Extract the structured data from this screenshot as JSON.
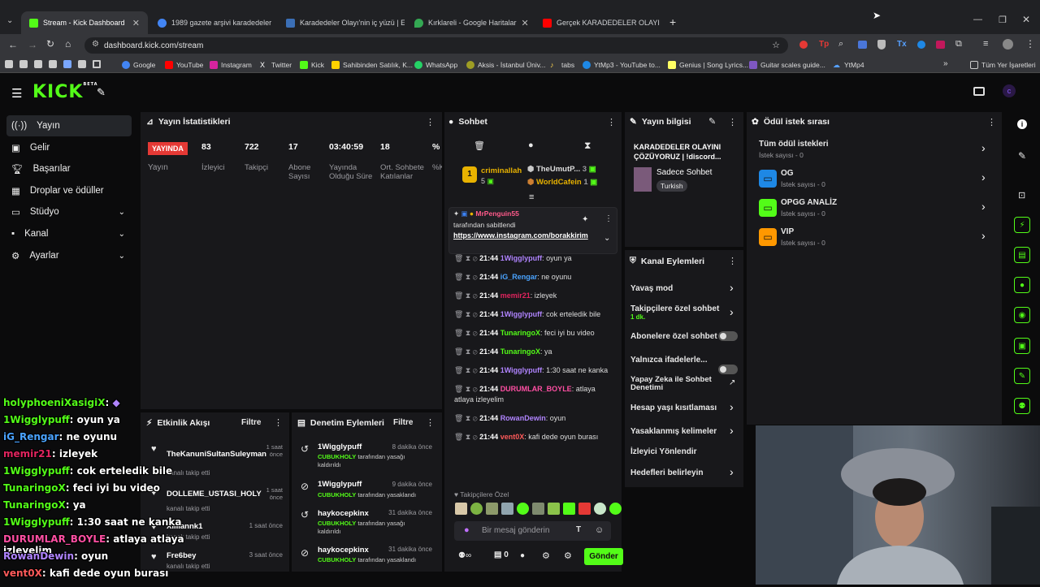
{
  "browser": {
    "tabs": [
      {
        "title": "Stream - Kick Dashboard",
        "color": "#53fc18"
      },
      {
        "title": "1989 gazete arşivi karadedeler",
        "color": "#4285f4"
      },
      {
        "title": "Karadedeler Olayı'nin iç yüzü | E",
        "color": "#3b6fb6"
      },
      {
        "title": "Kırklareli - Google Haritalar",
        "color": "#34a853"
      },
      {
        "title": "Gerçek KARADEDELER OLAYI - Y",
        "color": "#ff0000"
      }
    ],
    "url": "dashboard.kick.com/stream",
    "bookmarks": [
      "Google",
      "YouTube",
      "Instagram",
      "Twitter",
      "Kick",
      "Sahibinden Satılık, K...",
      "WhatsApp",
      "Aksis - İstanbul Üniv...",
      "tabs",
      "YtMp3 - YouTube to...",
      "Genius | Song Lyrics...",
      "Guitar scales guide...",
      "YtMp4"
    ],
    "all_bookmarks": "Tüm Yer İşaretleri"
  },
  "kick": {
    "logo": "KICK",
    "beta": "BETA"
  },
  "sidebar": {
    "items": [
      {
        "label": "Yayın",
        "icon": "radio-icon"
      },
      {
        "label": "Gelir",
        "icon": "dollar-icon"
      },
      {
        "label": "Başarılar",
        "icon": "trophy-icon"
      },
      {
        "label": "Droplar ve ödüller",
        "icon": "gift-icon"
      },
      {
        "label": "Stüdyo",
        "icon": "tv-icon"
      },
      {
        "label": "Kanal",
        "icon": "user-icon"
      },
      {
        "label": "Ayarlar",
        "icon": "gear-icon"
      }
    ]
  },
  "stats": {
    "title": "Yayın İstatistikleri",
    "live_badge": "YAYINDA",
    "live_label": "Yayın",
    "items": [
      {
        "value": "83",
        "label": "İzleyici"
      },
      {
        "value": "722",
        "label": "Takipçi"
      },
      {
        "value": "17",
        "label": "Abone Sayısı"
      },
      {
        "value": "03:40:59",
        "label": "Yayında Olduğu Süre"
      },
      {
        "value": "18",
        "label": "Ort. Sohbete Katılanlar"
      },
      {
        "value": "%",
        "label": "%Ka"
      }
    ]
  },
  "activity": {
    "title": "Etkinlik Akışı",
    "filter": "Filtre",
    "items": [
      {
        "name": "TheKanuniSultanSuleyman",
        "sub": "kanalı takip etti",
        "time": "1 saat önce"
      },
      {
        "name": "DOLLEME_USTASI_HOLY",
        "sub": "kanalı takip etti",
        "time": "1 saat önce"
      },
      {
        "name": "Xilliannk1",
        "sub": "kanalı takip etti",
        "time": "1 saat önce"
      },
      {
        "name": "Fre6bey",
        "sub": "kanalı takip etti",
        "time": "3 saat önce"
      }
    ]
  },
  "moderation": {
    "title": "Denetim Eylemleri",
    "filter": "Filtre",
    "items": [
      {
        "name": "1Wigglypuff",
        "by": "CUBUKHOLY",
        "action": "tarafından yasağı kaldırıldı",
        "time": "8 dakika önce"
      },
      {
        "name": "1Wigglypuff",
        "by": "CUBUKHOLY",
        "action": "tarafından yasaklandı",
        "time": "9 dakika önce"
      },
      {
        "name": "haykocepkinx",
        "by": "CUBUKHOLY",
        "action": "tarafından yasağı kaldırıldı",
        "time": "31 dakika önce"
      },
      {
        "name": "haykocepkinx",
        "by": "CUBUKHOLY",
        "action": "tarafından yasaklandı",
        "time": "31 dakika önce"
      }
    ]
  },
  "chat": {
    "title": "Sohbet",
    "top_gifters": [
      {
        "rank": "1",
        "name": "criminallah",
        "count": "5"
      },
      {
        "name": "TheUmutP...",
        "count": "3"
      },
      {
        "name": "WorldCafein",
        "count": "1"
      }
    ],
    "pinned": {
      "user": "MrPenguin55",
      "by": "tarafından sabitlendi",
      "link": "https://www.instagram.com/borakkirim"
    },
    "messages": [
      {
        "time": "21:44",
        "user": "1Wigglypuff",
        "color": "#b084ff",
        "text": "oyun ya"
      },
      {
        "time": "21:44",
        "user": "iG_Rengar",
        "color": "#4aa3ff",
        "text": "ne oyunu"
      },
      {
        "time": "21:44",
        "user": "memir21",
        "color": "#e0245e",
        "text": "izleyek"
      },
      {
        "time": "21:44",
        "user": "1Wigglypuff",
        "color": "#b084ff",
        "text": "cok erteledik bile"
      },
      {
        "time": "21:44",
        "user": "TunaringoX",
        "color": "#53fc18",
        "text": "feci iyi bu video"
      },
      {
        "time": "21:44",
        "user": "TunaringoX",
        "color": "#53fc18",
        "text": "ya"
      },
      {
        "time": "21:44",
        "user": "1Wigglypuff",
        "color": "#b084ff",
        "text": "1:30 saat ne kanka"
      },
      {
        "time": "21:44",
        "user": "DURUMLAR_BOYLE",
        "color": "#ff4fa3",
        "text": "atlaya atlaya izleyelim"
      },
      {
        "time": "21:44",
        "user": "RowanDewin",
        "color": "#b084ff",
        "text": "oyun"
      },
      {
        "time": "21:44",
        "user": "vent0X",
        "color": "#ff5a5a",
        "text": "kafi dede oyun burası"
      }
    ],
    "emote_label": "Takipçilere Özel",
    "placeholder": "Bir mesaj gönderin",
    "send": "Gönder",
    "count": "0"
  },
  "streaminfo": {
    "title": "Yayın bilgisi",
    "stream_title": "KARADEDELER OLAYINI ÇÖZÜYORUZ | !discord...",
    "category": "Sadece Sohbet",
    "tag": "Turkish"
  },
  "actions": {
    "title": "Kanal Eylemleri",
    "items": [
      {
        "label": "Yavaş mod",
        "type": "arrow"
      },
      {
        "label": "Takipçilere özel sohbet",
        "sub": "1 dk.",
        "type": "arrow"
      },
      {
        "label": "Abonelere özel sohbet",
        "type": "toggle"
      },
      {
        "label": "Yalnızca ifadelerle...",
        "type": "toggle"
      },
      {
        "label": "Yapay Zeka ile Sohbet Denetimi",
        "type": "external"
      },
      {
        "label": "Hesap yaşı kısıtlaması",
        "type": "arrow"
      },
      {
        "label": "Yasaklanmış kelimeler",
        "type": "arrow"
      },
      {
        "label": "İzleyici Yönlendir",
        "type": "none"
      },
      {
        "label": "Hedefleri belirleyin",
        "type": "arrow"
      }
    ]
  },
  "rewards": {
    "title": "Ödül istek sırası",
    "items": [
      {
        "label": "Tüm ödül istekleri",
        "sub": "İstek sayısı - 0",
        "color": ""
      },
      {
        "label": "OG",
        "sub": "İstek sayısı - 0",
        "color": "#1e88e5"
      },
      {
        "label": "OPGG ANALİZ",
        "sub": "İstek sayısı - 0",
        "color": "#53fc18"
      },
      {
        "label": "VIP",
        "sub": "İstek sayısı - 0",
        "color": "#ff9800"
      }
    ]
  },
  "overlay_chat": [
    {
      "user": "holyphoeniXasigiX",
      "color": "#53fc18",
      "text": ""
    },
    {
      "user": "1Wigglypuff",
      "color": "#53fc18",
      "text": "oyun ya"
    },
    {
      "user": "iG_Rengar",
      "color": "#4aa3ff",
      "text": "ne oyunu"
    },
    {
      "user": "memir21",
      "color": "#e0245e",
      "text": "izleyek"
    },
    {
      "user": "1Wigglypuff",
      "color": "#53fc18",
      "text": "cok erteledik bile"
    },
    {
      "user": "TunaringoX",
      "color": "#53fc18",
      "text": "feci iyi bu video"
    },
    {
      "user": "TunaringoX",
      "color": "#53fc18",
      "text": "ya"
    },
    {
      "user": "1Wigglypuff",
      "color": "#53fc18",
      "text": "1:30 saat ne kanka"
    },
    {
      "user": "DURUMLAR_BOYLE",
      "color": "#ff4fa3",
      "text": "atlaya atlaya izleyelim"
    },
    {
      "user": "RowanDewin",
      "color": "#b084ff",
      "text": "oyun"
    },
    {
      "user": "vent0X",
      "color": "#ff5a5a",
      "text": "kafi dede oyun burası"
    }
  ]
}
